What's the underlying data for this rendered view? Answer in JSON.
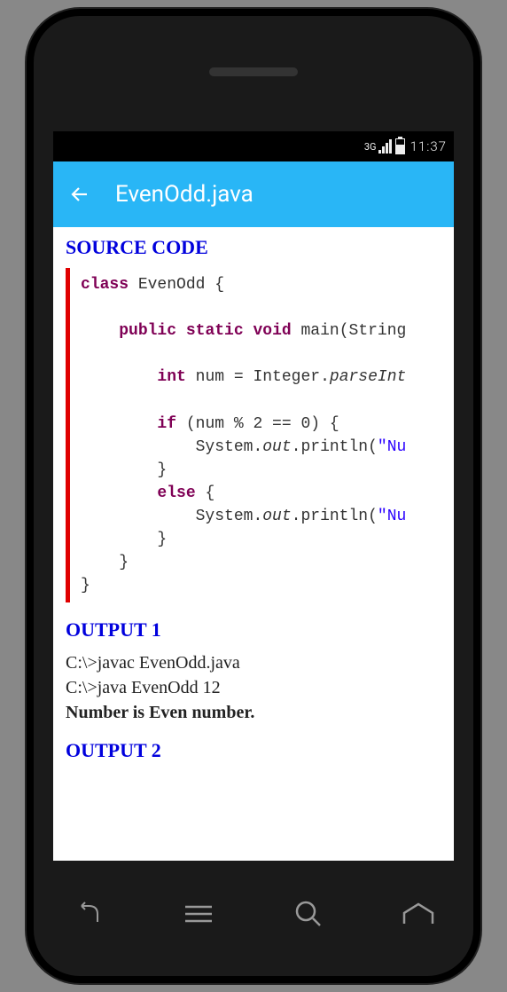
{
  "status": {
    "network": "3G",
    "time": "11:37"
  },
  "appbar": {
    "title": "EvenOdd.java"
  },
  "sections": {
    "source_code_heading": "SOURCE CODE",
    "output1_heading": "OUTPUT 1",
    "output2_heading": "OUTPUT 2"
  },
  "code": {
    "kw_class": "class",
    "name_class": "EvenOdd",
    "kw_public": "public",
    "kw_static": "static",
    "kw_void": "void",
    "fn_main": "main",
    "param_type": "String",
    "kw_int": "int",
    "var_num": "num",
    "cls_integer": "Integer",
    "fn_parseint": "parseInt",
    "kw_if": "if",
    "cond": "(num % 2 == 0)",
    "cls_system": "System",
    "fld_out": "out",
    "fn_println": "println",
    "str_nu": "\"Nu",
    "kw_else": "else"
  },
  "output1": {
    "line1": "C:\\>javac EvenOdd.java",
    "line2": "C:\\>java EvenOdd 12",
    "line3": "Number is Even number."
  }
}
